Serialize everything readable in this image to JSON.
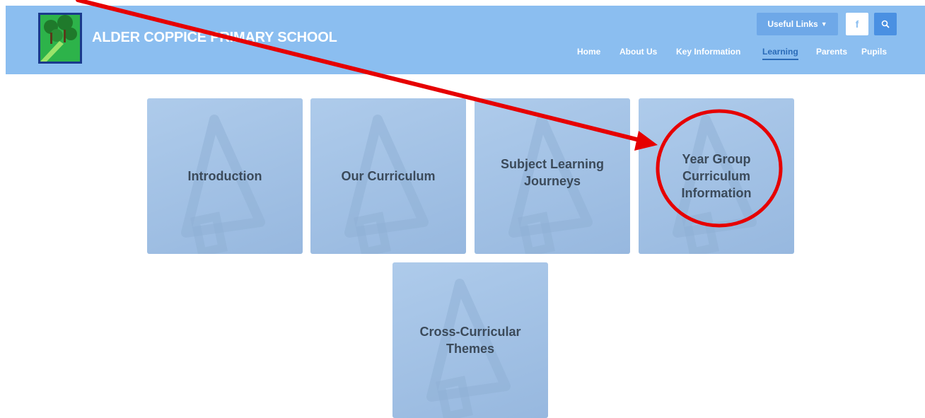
{
  "header": {
    "site_title": "ALDER COPPICE PRIMARY SCHOOL",
    "useful_links_label": "Useful Links",
    "facebook_glyph": "f",
    "nav": {
      "home": "Home",
      "about": "About Us",
      "key_info": "Key Information",
      "learning": "Learning",
      "parents": "Parents",
      "pupils": "Pupils"
    },
    "active_nav": "Learning"
  },
  "tiles": {
    "introduction": "Introduction",
    "our_curriculum": "Our Curriculum",
    "subject_learning_journeys": "Subject Learning Journeys",
    "year_group_curriculum": "Year Group Curriculum Information",
    "cross_curricular": "Cross-Curricular Themes"
  },
  "colors": {
    "header_bg": "#8bbef0",
    "tile_bg": "#a7c5e8",
    "annotation_red": "#e60000"
  },
  "icons": {
    "tile_background": "megaphone-icon",
    "search": "search-icon",
    "facebook": "facebook-icon",
    "dropdown": "chevron-down-icon"
  }
}
